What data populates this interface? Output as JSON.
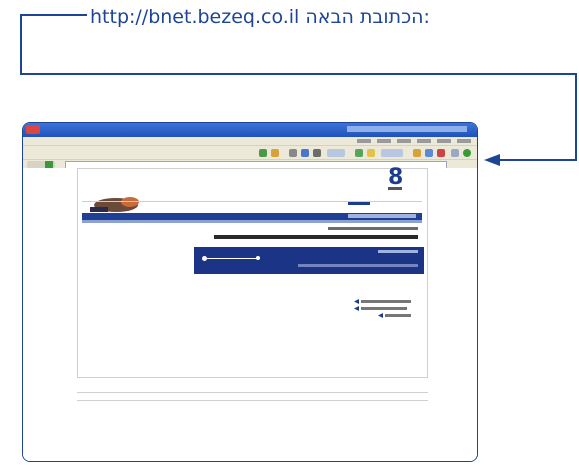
{
  "instruction": {
    "label": "הכתובת הבאה:",
    "url": "http://bnet.bezeq.co.il"
  },
  "browser": {
    "brand_number": "8",
    "colors": {
      "accent": "#1c4596",
      "page_header_blue": "#1f3f95",
      "progress_panel": "#1c3485"
    }
  }
}
